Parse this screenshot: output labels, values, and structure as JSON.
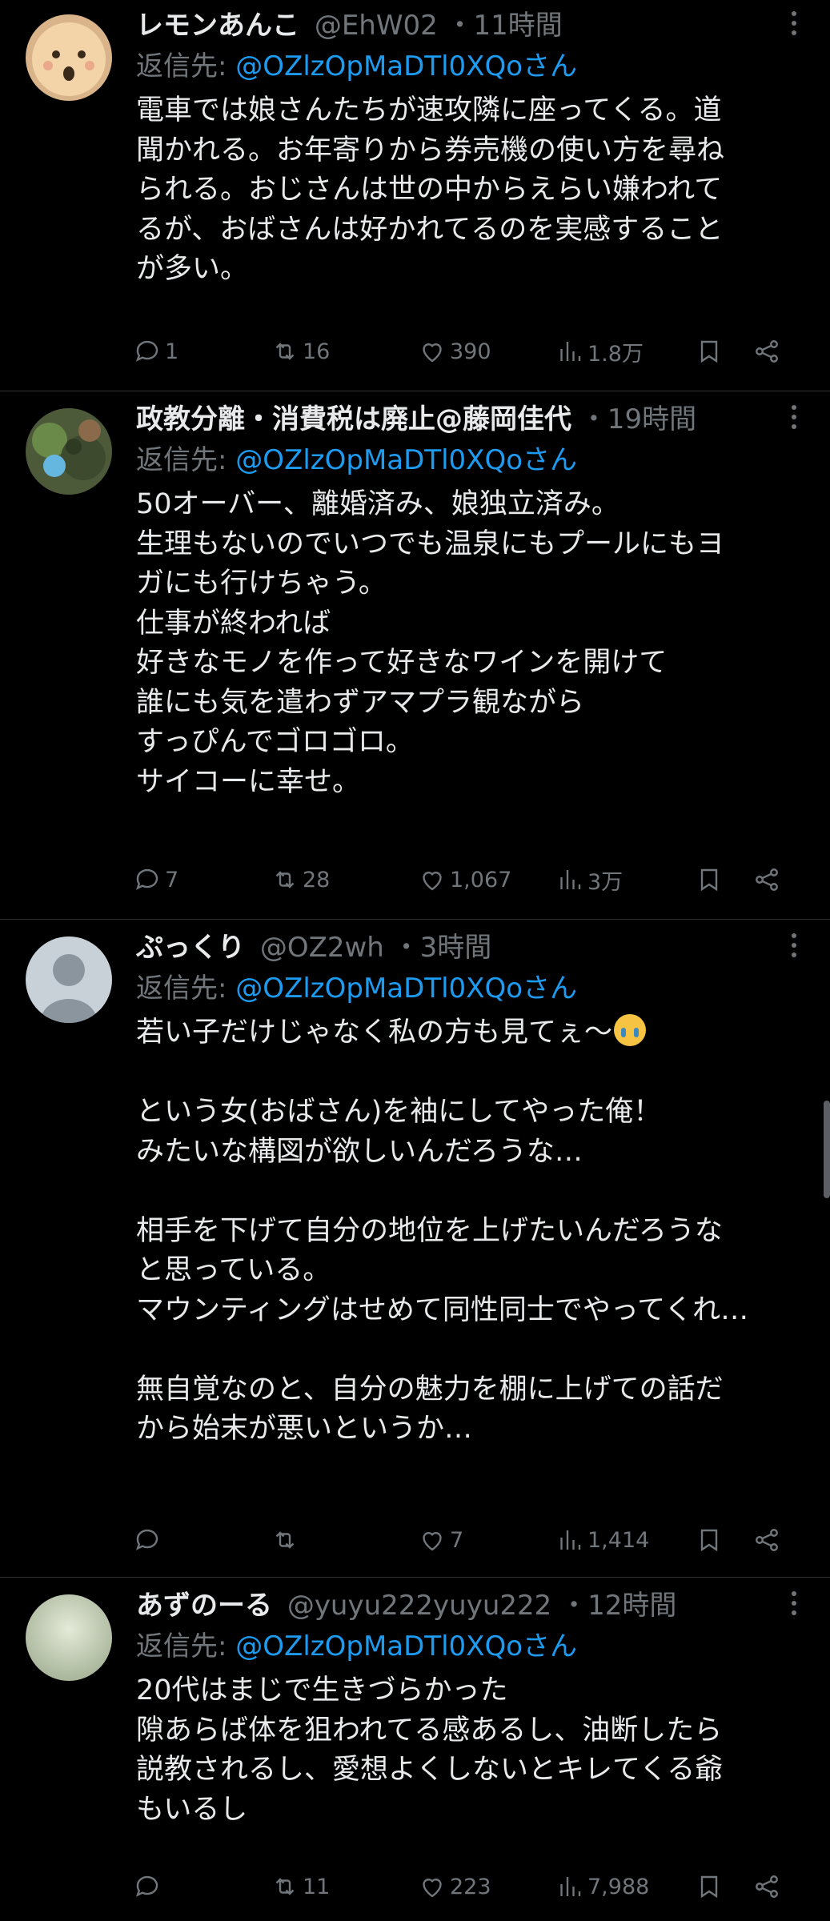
{
  "tweets": [
    {
      "name": "レモンあんこ",
      "handle": "@EhW02",
      "time": "・11時間",
      "reply_label": "返信先: ",
      "reply_to": "@OZlzOpMaDTl0XQoさん",
      "lines": [
        "電車では娘さんたちが速攻隣に座ってくる。道",
        "聞かれる。お年寄りから券売機の使い方を尋ね",
        "られる。おじさんは世の中からえらい嫌われて",
        "るが、おばさんは好かれてるのを実感すること",
        "が多い。"
      ],
      "replies": "1",
      "retweets": "16",
      "likes": "390",
      "views": "1.8万"
    },
    {
      "name": "政教分離・消費税は廃止@藤岡佳代",
      "handle": "",
      "time": "・19時間",
      "reply_label": "返信先: ",
      "reply_to": "@OZlzOpMaDTl0XQoさん",
      "lines": [
        "50オーバー、離婚済み、娘独立済み。",
        "生理もないのでいつでも温泉にもプールにもヨ",
        "ガにも行けちゃう。",
        "仕事が終われば",
        "好きなモノを作って好きなワインを開けて",
        "誰にも気を遣わずアマプラ観ながら",
        "すっぴんでゴロゴロ。",
        "サイコーに幸せ。"
      ],
      "replies": "7",
      "retweets": "28",
      "likes": "1,067",
      "views": "3万"
    },
    {
      "name": "ぷっくり",
      "handle": "@OZ2wh",
      "time": "・3時間",
      "reply_label": "返信先: ",
      "reply_to": "@OZlzOpMaDTl0XQoさん",
      "lines": [
        "若い子だけじゃなく私の方も見てぇ〜",
        "",
        "という女(おばさん)を袖にしてやった俺！",
        "みたいな構図が欲しいんだろうな…",
        "",
        "相手を下げて自分の地位を上げたいんだろうな",
        "と思っている。",
        "マウンティングはせめて同性同士でやってくれ…",
        "",
        "無自覚なのと、自分の魅力を棚に上げての話だ",
        "から始末が悪いというか…"
      ],
      "replies": "",
      "retweets": "",
      "likes": "7",
      "views": "1,414"
    },
    {
      "name": "あずのーる",
      "handle": "@yuyu222yuyu222",
      "time": "・12時間",
      "reply_label": "返信先: ",
      "reply_to": "@OZlzOpMaDTl0XQoさん",
      "lines": [
        "20代はまじで生きづらかった",
        "隙あらば体を狙われてる感あるし、油断したら",
        "説教されるし、愛想よくしないとキレてくる爺",
        "もいるし"
      ],
      "replies": "",
      "retweets": "11",
      "likes": "223",
      "views": "7,988"
    }
  ],
  "emoji_icon": "loudly-crying-face-icon",
  "colors": {
    "background": "#000000",
    "text": "#e7e9ea",
    "muted": "#71767b",
    "link": "#1d9bf0",
    "divider": "#2f3336"
  }
}
